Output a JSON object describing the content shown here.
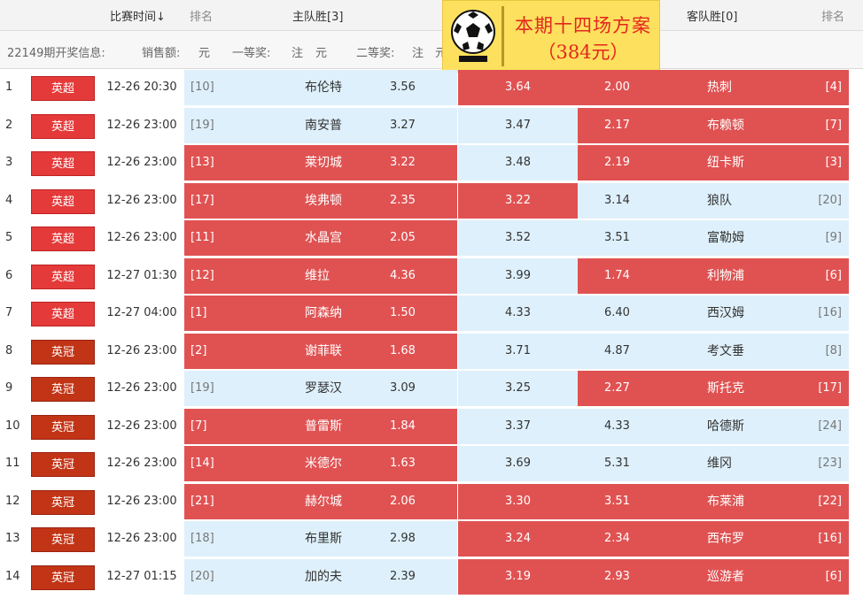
{
  "header": {
    "time_label": "比赛时间↓",
    "rank_label": "排名",
    "home_label": "主队胜[3]",
    "away_label": "客队胜[0]",
    "rank_label_right": "排名"
  },
  "info": {
    "issue": "22149期开奖信息:",
    "sales": "销售额:",
    "yuan1": "元",
    "first": "一等奖:",
    "zhu1": "注",
    "yuan2": "元",
    "second": "二等奖:",
    "zhu2": "注",
    "yuan3": "元"
  },
  "promo": {
    "line1": "本期十四场方案",
    "line2": "（384元）",
    "logo_icon": "soccer-ball-icon"
  },
  "colors": {
    "highlight": "#e05252",
    "normal_bg": "#def0fb",
    "league_epl": "#e43a3a",
    "league_efl": "#c23416",
    "promo_bg": "#fde05d",
    "promo_text": "#e2261e"
  },
  "rows": [
    {
      "no": "1",
      "league": "英超",
      "league_type": "epl",
      "time": "12-26 20:30",
      "home_rank": "[10]",
      "home": "布伦特",
      "home_odds": "3.56",
      "draw": "3.64",
      "away_odds": "2.00",
      "away": "热刺",
      "away_rank": "[4]",
      "hl": [
        "draw",
        "away"
      ]
    },
    {
      "no": "2",
      "league": "英超",
      "league_type": "epl",
      "time": "12-26 23:00",
      "home_rank": "[19]",
      "home": "南安普",
      "home_odds": "3.27",
      "draw": "3.47",
      "away_odds": "2.17",
      "away": "布赖顿",
      "away_rank": "[7]",
      "hl": [
        "away"
      ]
    },
    {
      "no": "3",
      "league": "英超",
      "league_type": "epl",
      "time": "12-26 23:00",
      "home_rank": "[13]",
      "home": "莱切城",
      "home_odds": "3.22",
      "draw": "3.48",
      "away_odds": "2.19",
      "away": "纽卡斯",
      "away_rank": "[3]",
      "hl": [
        "home",
        "away"
      ]
    },
    {
      "no": "4",
      "league": "英超",
      "league_type": "epl",
      "time": "12-26 23:00",
      "home_rank": "[17]",
      "home": "埃弗顿",
      "home_odds": "2.35",
      "draw": "3.22",
      "away_odds": "3.14",
      "away": "狼队",
      "away_rank": "[20]",
      "hl": [
        "home",
        "draw"
      ]
    },
    {
      "no": "5",
      "league": "英超",
      "league_type": "epl",
      "time": "12-26 23:00",
      "home_rank": "[11]",
      "home": "水晶宫",
      "home_odds": "2.05",
      "draw": "3.52",
      "away_odds": "3.51",
      "away": "富勒姆",
      "away_rank": "[9]",
      "hl": [
        "home"
      ]
    },
    {
      "no": "6",
      "league": "英超",
      "league_type": "epl",
      "time": "12-27 01:30",
      "home_rank": "[12]",
      "home": "维拉",
      "home_odds": "4.36",
      "draw": "3.99",
      "away_odds": "1.74",
      "away": "利物浦",
      "away_rank": "[6]",
      "hl": [
        "home",
        "away"
      ]
    },
    {
      "no": "7",
      "league": "英超",
      "league_type": "epl",
      "time": "12-27 04:00",
      "home_rank": "[1]",
      "home": "阿森纳",
      "home_odds": "1.50",
      "draw": "4.33",
      "away_odds": "6.40",
      "away": "西汉姆",
      "away_rank": "[16]",
      "hl": [
        "home"
      ]
    },
    {
      "no": "8",
      "league": "英冠",
      "league_type": "efl",
      "time": "12-26 23:00",
      "home_rank": "[2]",
      "home": "谢菲联",
      "home_odds": "1.68",
      "draw": "3.71",
      "away_odds": "4.87",
      "away": "考文垂",
      "away_rank": "[8]",
      "hl": [
        "home"
      ]
    },
    {
      "no": "9",
      "league": "英冠",
      "league_type": "efl",
      "time": "12-26 23:00",
      "home_rank": "[19]",
      "home": "罗瑟汉",
      "home_odds": "3.09",
      "draw": "3.25",
      "away_odds": "2.27",
      "away": "斯托克",
      "away_rank": "[17]",
      "hl": [
        "away"
      ]
    },
    {
      "no": "10",
      "league": "英冠",
      "league_type": "efl",
      "time": "12-26 23:00",
      "home_rank": "[7]",
      "home": "普雷斯",
      "home_odds": "1.84",
      "draw": "3.37",
      "away_odds": "4.33",
      "away": "哈德斯",
      "away_rank": "[24]",
      "hl": [
        "home"
      ]
    },
    {
      "no": "11",
      "league": "英冠",
      "league_type": "efl",
      "time": "12-26 23:00",
      "home_rank": "[14]",
      "home": "米德尔",
      "home_odds": "1.63",
      "draw": "3.69",
      "away_odds": "5.31",
      "away": "维冈",
      "away_rank": "[23]",
      "hl": [
        "home"
      ]
    },
    {
      "no": "12",
      "league": "英冠",
      "league_type": "efl",
      "time": "12-26 23:00",
      "home_rank": "[21]",
      "home": "赫尔城",
      "home_odds": "2.06",
      "draw": "3.30",
      "away_odds": "3.51",
      "away": "布莱浦",
      "away_rank": "[22]",
      "hl": [
        "home",
        "draw",
        "away"
      ]
    },
    {
      "no": "13",
      "league": "英冠",
      "league_type": "efl",
      "time": "12-26 23:00",
      "home_rank": "[18]",
      "home": "布里斯",
      "home_odds": "2.98",
      "draw": "3.24",
      "away_odds": "2.34",
      "away": "西布罗",
      "away_rank": "[16]",
      "hl": [
        "draw",
        "away"
      ]
    },
    {
      "no": "14",
      "league": "英冠",
      "league_type": "efl",
      "time": "12-27 01:15",
      "home_rank": "[20]",
      "home": "加的夫",
      "home_odds": "2.39",
      "draw": "3.19",
      "away_odds": "2.93",
      "away": "巡游者",
      "away_rank": "[6]",
      "hl": [
        "draw",
        "away"
      ]
    }
  ]
}
